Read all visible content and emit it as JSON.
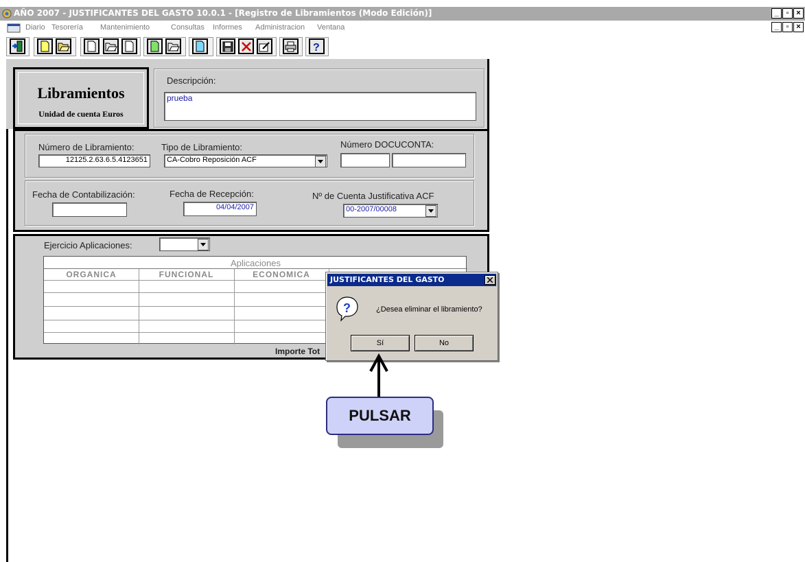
{
  "window": {
    "title": "AÑO 2007 - JUSTIFICANTES DEL GASTO 10.0.1 - [Registro de Libramientos (Modo Edición)]"
  },
  "menu": {
    "items": [
      "Diario",
      "Tesorería",
      "Mantenimiento",
      "Consultas",
      "Informes",
      "Administracion",
      "Ventana"
    ]
  },
  "toolbar": {
    "buttons": [
      "exit-icon",
      "new-icon",
      "open-icon",
      "new-icon",
      "open-icon",
      "new-icon",
      "new-icon",
      "open-icon",
      "new-icon",
      "save-icon",
      "delete-icon",
      "edit-icon",
      "print-icon",
      "help-icon"
    ]
  },
  "header": {
    "title": "Libramientos",
    "subtitle": "Unidad de cuenta Euros"
  },
  "form": {
    "descripcion_label": "Descripción:",
    "descripcion_value": "prueba",
    "numero_libramiento_label": "Número de Libramiento:",
    "numero_libramiento_value": "12125.2.63.6.5.4123651",
    "tipo_libramiento_label": "Tipo de Libramiento:",
    "tipo_libramiento_value": "CA-Cobro Reposición ACF",
    "docuconta_label": "Número DOCUCONTA:",
    "docuconta_value_1": "",
    "docuconta_value_2": "",
    "fecha_contabilizacion_label": "Fecha de Contabilización:",
    "fecha_contabilizacion_value": "",
    "fecha_recepcion_label": "Fecha de Recepción:",
    "fecha_recepcion_value": "04/04/2007",
    "cuenta_justificativa_label": "Nº de Cuenta Justificativa ACF",
    "cuenta_justificativa_value": "00-2007/00008"
  },
  "aplicaciones": {
    "ejercicio_label": "Ejercicio Aplicaciones:",
    "ejercicio_value": "",
    "table_title": "Aplicaciones",
    "columns": [
      "ORGANICA",
      "FUNCIONAL",
      "ECONOMICA"
    ],
    "importe_label": "Importe Tot"
  },
  "dialog": {
    "title": "JUSTIFICANTES DEL GASTO",
    "message": "¿Desea eliminar el libramiento?",
    "yes_label": "Sí",
    "no_label": "No"
  },
  "callout": {
    "text": "PULSAR"
  },
  "colors": {
    "titlebar": "#a9a9a9",
    "dialog_title": "#0a2a8c",
    "form_bg": "#cfcfcf",
    "value_text": "#1a1aa6",
    "callout_bg": "#cfd2f8"
  }
}
